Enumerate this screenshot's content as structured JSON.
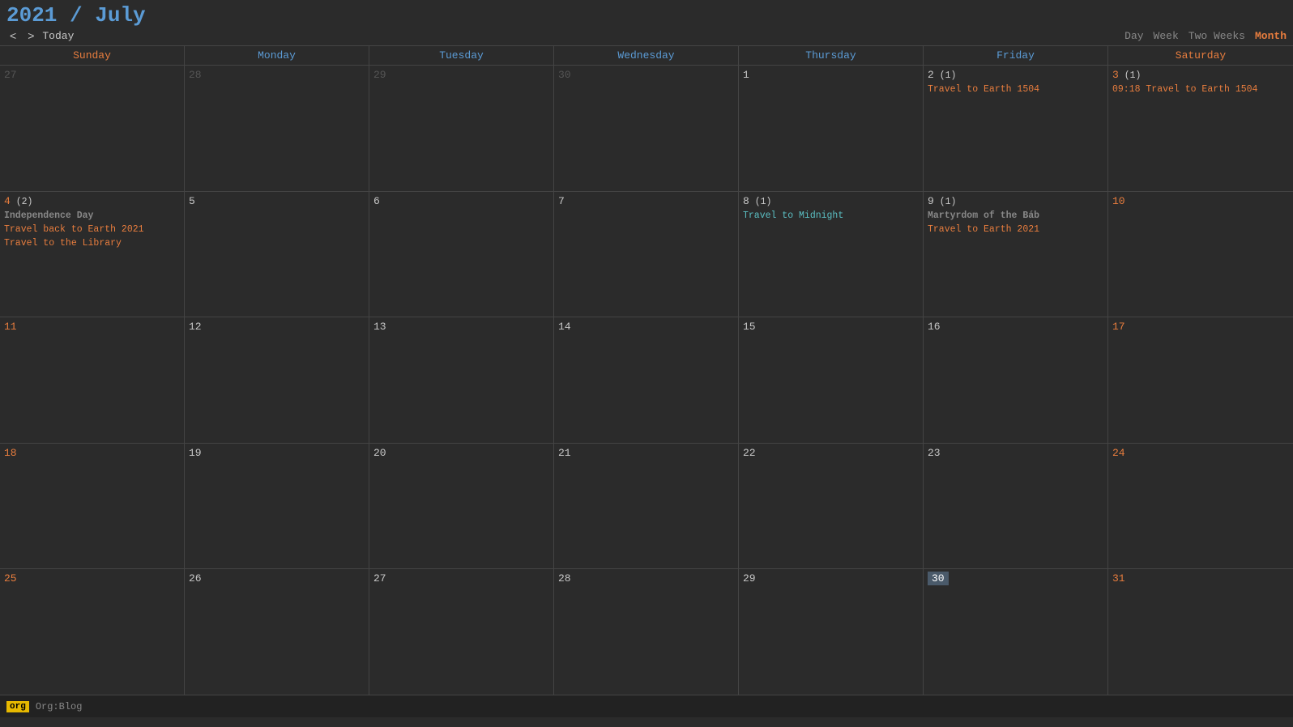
{
  "header": {
    "title_year": "2021",
    "title_slash": " / ",
    "title_month": "July",
    "nav_prev": "<",
    "nav_next": ">",
    "today_label": "Today"
  },
  "view_switcher": {
    "day": "Day",
    "week": "Week",
    "two_weeks": "Two Weeks",
    "month": "Month"
  },
  "day_headers": [
    {
      "label": "Sunday",
      "type": "weekend"
    },
    {
      "label": "Monday",
      "type": "weekday"
    },
    {
      "label": "Tuesday",
      "type": "weekday"
    },
    {
      "label": "Wednesday",
      "type": "weekday"
    },
    {
      "label": "Thursday",
      "type": "weekday"
    },
    {
      "label": "Friday",
      "type": "weekday"
    },
    {
      "label": "Saturday",
      "type": "weekend"
    }
  ],
  "weeks": [
    {
      "days": [
        {
          "num": "27",
          "other": true,
          "events": []
        },
        {
          "num": "28",
          "other": true,
          "events": []
        },
        {
          "num": "29",
          "other": true,
          "events": []
        },
        {
          "num": "30",
          "other": true,
          "events": []
        },
        {
          "num": "1",
          "other": false,
          "weekend": false,
          "events": []
        },
        {
          "num": "2",
          "other": false,
          "weekend": false,
          "count": "(1)",
          "events": [
            {
              "text": "Travel to Earth 1504",
              "type": "orange"
            }
          ]
        },
        {
          "num": "3",
          "other": false,
          "weekend": true,
          "count": "(1)",
          "events": [
            {
              "text": "09:18 Travel to Earth 1504",
              "type": "orange"
            }
          ]
        }
      ]
    },
    {
      "days": [
        {
          "num": "4",
          "other": false,
          "weekend": true,
          "count": "(2)",
          "events": [
            {
              "text": "Independence Day",
              "type": "holiday"
            },
            {
              "text": "Travel back to Earth 2021",
              "type": "orange"
            },
            {
              "text": "Travel to the Library",
              "type": "orange"
            }
          ]
        },
        {
          "num": "5",
          "other": false,
          "weekend": false,
          "events": []
        },
        {
          "num": "6",
          "other": false,
          "weekend": false,
          "events": []
        },
        {
          "num": "7",
          "other": false,
          "weekend": false,
          "events": []
        },
        {
          "num": "8",
          "other": false,
          "weekend": false,
          "count": "(1)",
          "events": [
            {
              "text": "Travel to Midnight",
              "type": "cyan"
            }
          ]
        },
        {
          "num": "9",
          "other": false,
          "weekend": false,
          "count": "(1)",
          "events": [
            {
              "text": "Martyrdom of the Báb",
              "type": "holiday"
            },
            {
              "text": "Travel to Earth 2021",
              "type": "orange"
            }
          ]
        },
        {
          "num": "10",
          "other": false,
          "weekend": true,
          "events": []
        }
      ]
    },
    {
      "days": [
        {
          "num": "11",
          "other": false,
          "weekend": true,
          "events": []
        },
        {
          "num": "12",
          "other": false,
          "weekend": false,
          "events": []
        },
        {
          "num": "13",
          "other": false,
          "weekend": false,
          "events": []
        },
        {
          "num": "14",
          "other": false,
          "weekend": false,
          "events": []
        },
        {
          "num": "15",
          "other": false,
          "weekend": false,
          "events": []
        },
        {
          "num": "16",
          "other": false,
          "weekend": false,
          "events": []
        },
        {
          "num": "17",
          "other": false,
          "weekend": true,
          "events": []
        }
      ]
    },
    {
      "days": [
        {
          "num": "18",
          "other": false,
          "weekend": true,
          "events": []
        },
        {
          "num": "19",
          "other": false,
          "weekend": false,
          "events": []
        },
        {
          "num": "20",
          "other": false,
          "weekend": false,
          "events": []
        },
        {
          "num": "21",
          "other": false,
          "weekend": false,
          "events": []
        },
        {
          "num": "22",
          "other": false,
          "weekend": false,
          "events": []
        },
        {
          "num": "23",
          "other": false,
          "weekend": false,
          "events": []
        },
        {
          "num": "24",
          "other": false,
          "weekend": true,
          "events": []
        }
      ]
    },
    {
      "days": [
        {
          "num": "25",
          "other": false,
          "weekend": true,
          "events": []
        },
        {
          "num": "26",
          "other": false,
          "weekend": false,
          "events": []
        },
        {
          "num": "27",
          "other": false,
          "weekend": false,
          "events": []
        },
        {
          "num": "28",
          "other": false,
          "weekend": false,
          "events": []
        },
        {
          "num": "29",
          "other": false,
          "weekend": false,
          "events": []
        },
        {
          "num": "30",
          "other": false,
          "weekend": false,
          "today": true,
          "events": []
        },
        {
          "num": "31",
          "other": false,
          "weekend": true,
          "events": []
        }
      ]
    }
  ],
  "status_bar": {
    "tag": "org",
    "text": "Org:Blog"
  }
}
